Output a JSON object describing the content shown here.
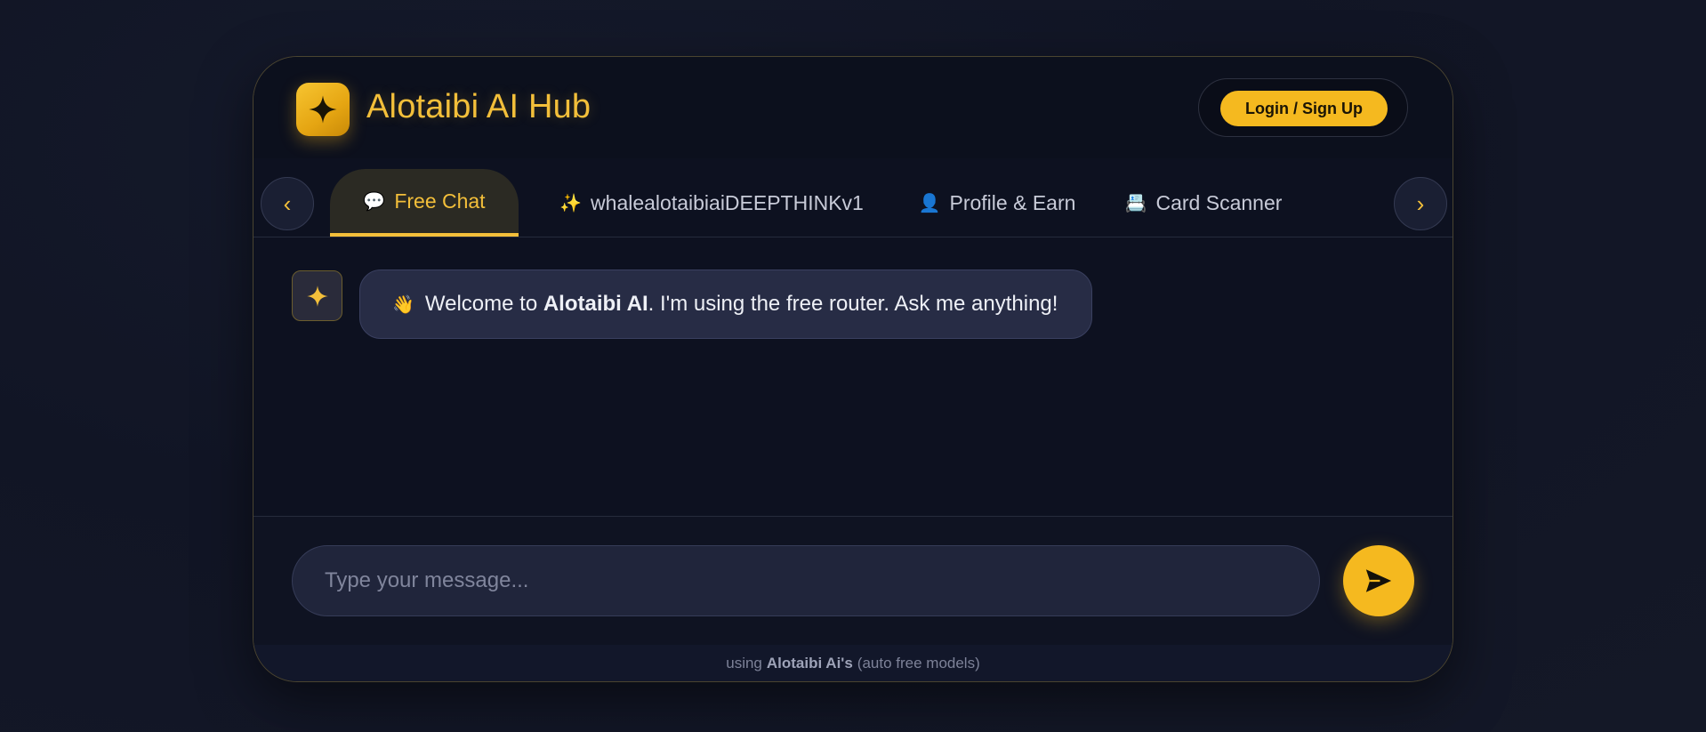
{
  "header": {
    "logo_icon": "sparkle-icon",
    "title": "Alotaibi AI Hub",
    "login_label": "Login / Sign Up"
  },
  "tabs": {
    "prev_label": "‹",
    "next_label": "›",
    "items": [
      {
        "icon": "💬",
        "label": "Free Chat",
        "active": true
      },
      {
        "icon": "✨",
        "label": "whalealotaibiaiDEEPTHINKv1",
        "active": false
      },
      {
        "icon": "👤",
        "label": "Profile & Earn",
        "active": false
      },
      {
        "icon": "📇",
        "label": "Card Scanner",
        "active": false
      }
    ]
  },
  "chat": {
    "messages": [
      {
        "role": "bot",
        "emoji": "👋",
        "prefix": "Welcome to ",
        "bold": "Alotaibi AI",
        "suffix": ". I'm using the free router. Ask me anything!"
      }
    ]
  },
  "composer": {
    "placeholder": "Type your message...",
    "send_icon": "send-icon"
  },
  "footer": {
    "prefix": "using",
    "bold": "Alotaibi Ai's",
    "suffix": "(auto free models)"
  },
  "colors": {
    "accent": "#f5b91f",
    "background": "#0d1120",
    "bubble": "#272c45"
  }
}
